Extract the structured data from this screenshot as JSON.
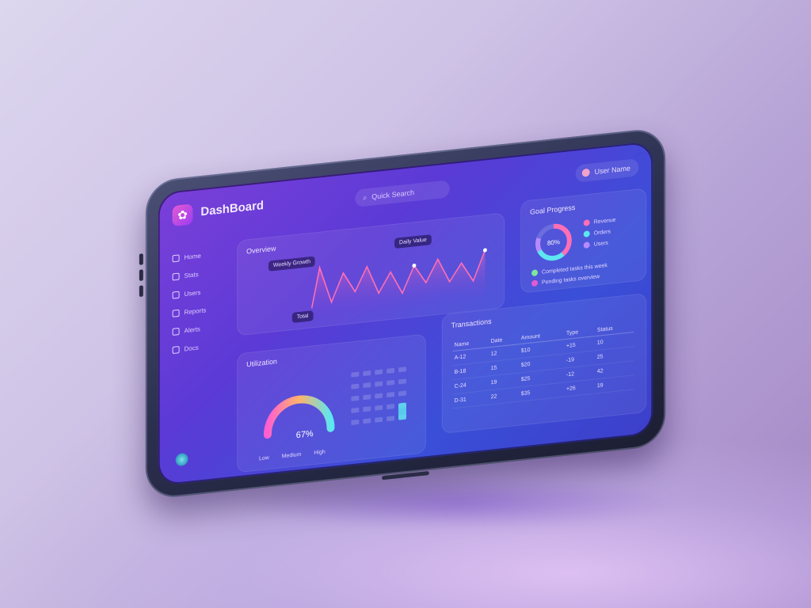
{
  "app": {
    "title": "DashBoard"
  },
  "header": {
    "search_label": "Quick Search",
    "user_label": "User Name"
  },
  "sidebar": {
    "items": [
      {
        "label": "Home",
        "icon": "home-icon"
      },
      {
        "label": "Stats",
        "icon": "chart-icon"
      },
      {
        "label": "Users",
        "icon": "users-icon"
      },
      {
        "label": "Reports",
        "icon": "file-icon"
      },
      {
        "label": "Alerts",
        "icon": "bell-icon"
      },
      {
        "label": "Docs",
        "icon": "doc-icon"
      }
    ]
  },
  "line_card": {
    "title": "Overview",
    "chip_left": "Weekly Growth",
    "chip_mid": "Daily Value",
    "chip_bottom": "Total"
  },
  "donut_card": {
    "title": "Goal Progress",
    "center_label": "80%",
    "legend": [
      "Revenue",
      "Orders",
      "Users"
    ],
    "notes": [
      "Completed tasks this week",
      "Pending tasks overview"
    ]
  },
  "gauge_card": {
    "title": "Utilization",
    "value": "67%",
    "legend": [
      "Low",
      "Medium",
      "High"
    ]
  },
  "table_card": {
    "title": "Transactions",
    "headers": [
      "Name",
      "Date",
      "Amount",
      "Type",
      "Status"
    ],
    "rows": [
      [
        "A-12",
        "12",
        "$10",
        "+15",
        "10"
      ],
      [
        "B-18",
        "15",
        "$20",
        "-19",
        "25"
      ],
      [
        "C-24",
        "19",
        "$25",
        "-12",
        "42"
      ],
      [
        "D-31",
        "22",
        "$35",
        "+26",
        "19"
      ]
    ]
  },
  "colors": {
    "accent": "#e35bd2",
    "line": "#ff6fb5",
    "gauge_start": "#ff5fcf",
    "gauge_end": "#5de7f0"
  }
}
